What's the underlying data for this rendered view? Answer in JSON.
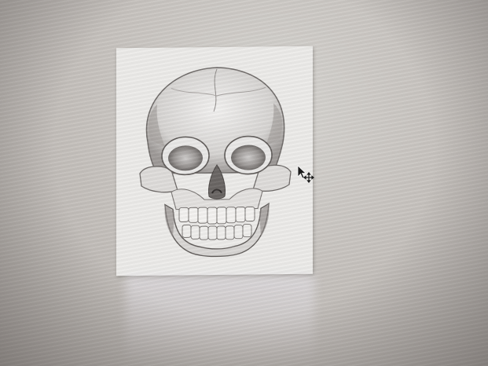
{
  "desktop": {
    "background_color": "#c7c3bf"
  },
  "image_window": {
    "image_subject": "skull-drawing",
    "paper_color": "#ecebe9"
  },
  "cursor": {
    "type": "move-cursor",
    "icon": "arrow-with-move-cross"
  }
}
